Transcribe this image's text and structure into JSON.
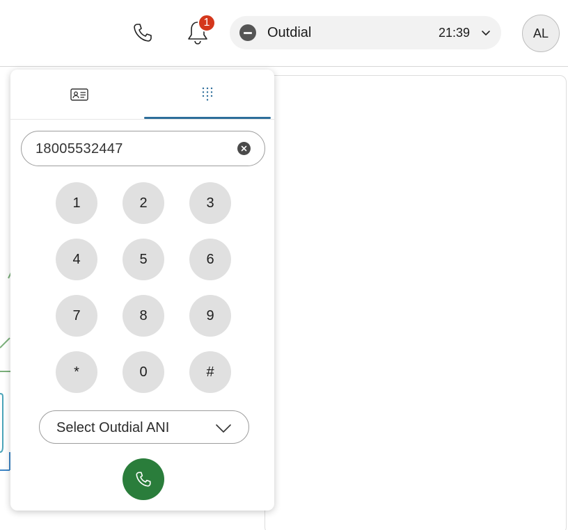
{
  "topbar": {
    "notifications_count": "1",
    "state": {
      "label": "Outdial",
      "time": "21:39"
    },
    "avatar_initials": "AL"
  },
  "dialpad": {
    "tabs": [
      {
        "name": "contacts",
        "icon": "contact-card-icon",
        "active": false
      },
      {
        "name": "keypad",
        "icon": "keypad-icon",
        "active": true
      }
    ],
    "number_value": "18005532447",
    "keys": [
      "1",
      "2",
      "3",
      "4",
      "5",
      "6",
      "7",
      "8",
      "9",
      "*",
      "0",
      "#"
    ],
    "ani_select_label": "Select Outdial ANI",
    "accent_color": "#2d6e9a",
    "call_color": "#2a7d3b"
  }
}
